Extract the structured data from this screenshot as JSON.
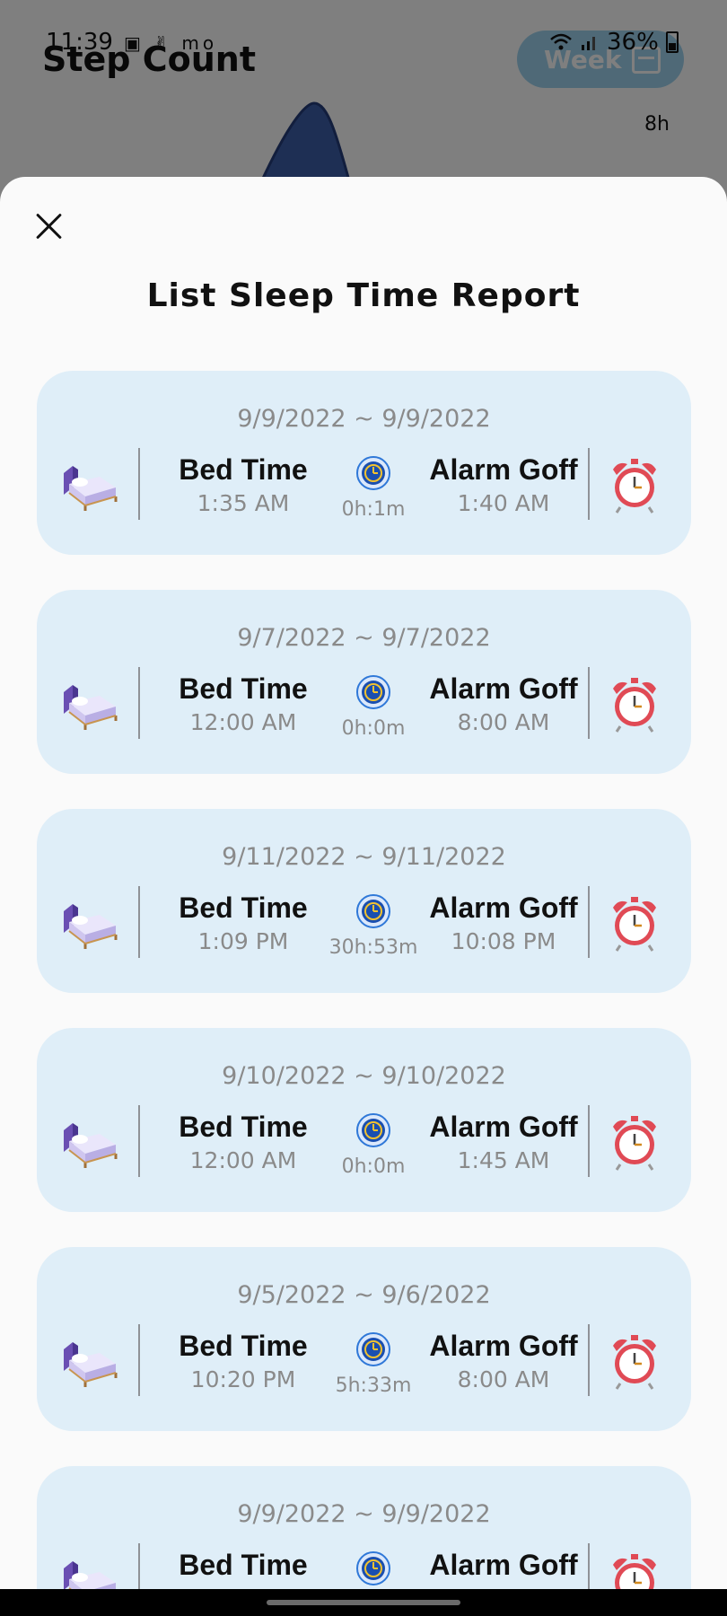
{
  "status_bar": {
    "time": "11:39",
    "left_icons": "▣ ✌ mo",
    "battery": "36%"
  },
  "background_app": {
    "title": "Step Count",
    "period_button": "Week",
    "axis_label": "8h"
  },
  "sheet": {
    "title": "List Sleep Time Report",
    "cards": [
      {
        "date": "9/9/2022 ~ 9/9/2022",
        "bed_label": "Bed Time",
        "bed_time": "1:35 AM",
        "duration": "0h:1m",
        "alarm_label": "Alarm Goff",
        "alarm_time": "1:40 AM"
      },
      {
        "date": "9/7/2022 ~ 9/7/2022",
        "bed_label": "Bed Time",
        "bed_time": "12:00 AM",
        "duration": "0h:0m",
        "alarm_label": "Alarm Goff",
        "alarm_time": "8:00 AM"
      },
      {
        "date": "9/11/2022 ~ 9/11/2022",
        "bed_label": "Bed Time",
        "bed_time": "1:09 PM",
        "duration": "30h:53m",
        "alarm_label": "Alarm Goff",
        "alarm_time": "10:08 PM"
      },
      {
        "date": "9/10/2022 ~ 9/10/2022",
        "bed_label": "Bed Time",
        "bed_time": "12:00 AM",
        "duration": "0h:0m",
        "alarm_label": "Alarm Goff",
        "alarm_time": "1:45 AM"
      },
      {
        "date": "9/5/2022 ~ 9/6/2022",
        "bed_label": "Bed Time",
        "bed_time": "10:20 PM",
        "duration": "5h:33m",
        "alarm_label": "Alarm Goff",
        "alarm_time": "8:00 AM"
      },
      {
        "date": "9/9/2022 ~ 9/9/2022",
        "bed_label": "Bed Time",
        "bed_time": "",
        "duration": "",
        "alarm_label": "Alarm Goff",
        "alarm_time": ""
      }
    ]
  },
  "icons": {
    "bed": "bed-icon",
    "clock": "clock-icon",
    "alarm": "alarm-clock-icon",
    "close": "close-icon"
  },
  "colors": {
    "card_background": "#dfeef8",
    "sheet_background": "#fafafa",
    "muted_text": "#8a8a8a",
    "clock_blue": "#1f5fc4",
    "alarm_red": "#e04a55"
  }
}
